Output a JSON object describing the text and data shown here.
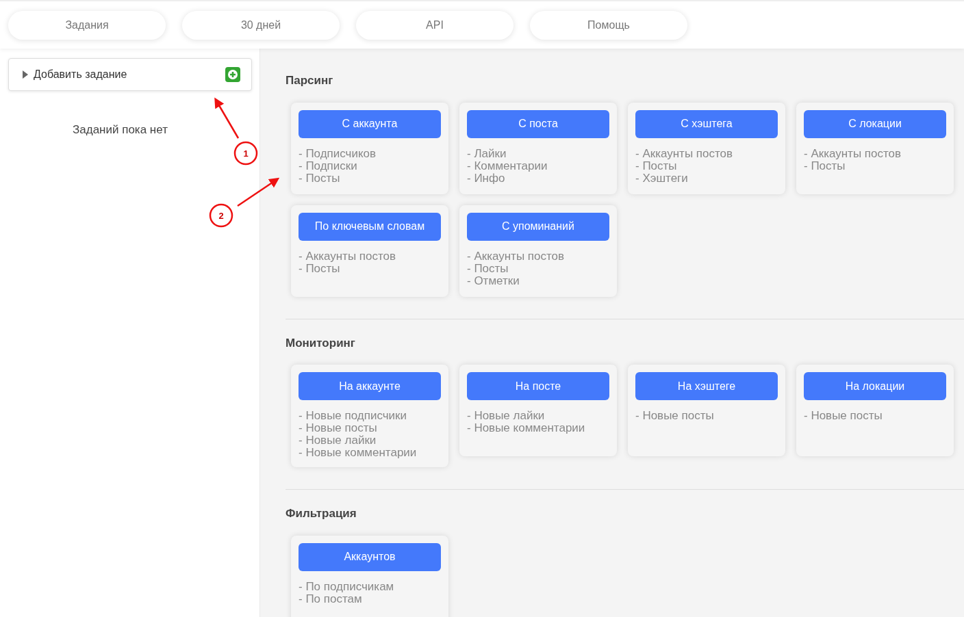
{
  "nav_tabs": [
    {
      "label": "Задания"
    },
    {
      "label": "30 дней"
    },
    {
      "label": "API"
    },
    {
      "label": "Помощь"
    }
  ],
  "sidebar": {
    "add_task": {
      "label": "Добавить задание",
      "expanded": false
    },
    "empty_text": "Заданий пока нет"
  },
  "annotations": [
    {
      "number": "1"
    },
    {
      "number": "2"
    }
  ],
  "sections": [
    {
      "title": "Парсинг",
      "cards": [
        {
          "button": "С аккаунта",
          "items": [
            "- Подписчиков",
            "- Подписки",
            "- Посты"
          ]
        },
        {
          "button": "С поста",
          "items": [
            "- Лайки",
            "- Комментарии",
            "- Инфо"
          ]
        },
        {
          "button": "С хэштега",
          "items": [
            "- Аккаунты постов",
            "- Посты",
            "- Хэштеги"
          ]
        },
        {
          "button": "С локации",
          "items": [
            "- Аккаунты постов",
            "- Посты"
          ]
        },
        {
          "button": "По ключевым словам",
          "items": [
            "- Аккаунты постов",
            "- Посты"
          ]
        },
        {
          "button": "С упоминаний",
          "items": [
            "- Аккаунты постов",
            "- Посты",
            "- Отметки"
          ]
        }
      ]
    },
    {
      "title": "Мониторинг",
      "cards": [
        {
          "button": "На аккаунте",
          "items": [
            "- Новые подписчики",
            "- Новые посты",
            "- Новые лайки",
            "- Новые комментарии"
          ]
        },
        {
          "button": "На посте",
          "items": [
            "- Новые лайки",
            "- Новые комментарии"
          ]
        },
        {
          "button": "На хэштеге",
          "items": [
            "- Новые посты"
          ]
        },
        {
          "button": "На локации",
          "items": [
            "- Новые посты"
          ]
        }
      ]
    },
    {
      "title": "Фильтрация",
      "cards": [
        {
          "button": "Аккаунтов",
          "items": [
            "- По подписчикам",
            "- По постам"
          ]
        }
      ]
    }
  ]
}
